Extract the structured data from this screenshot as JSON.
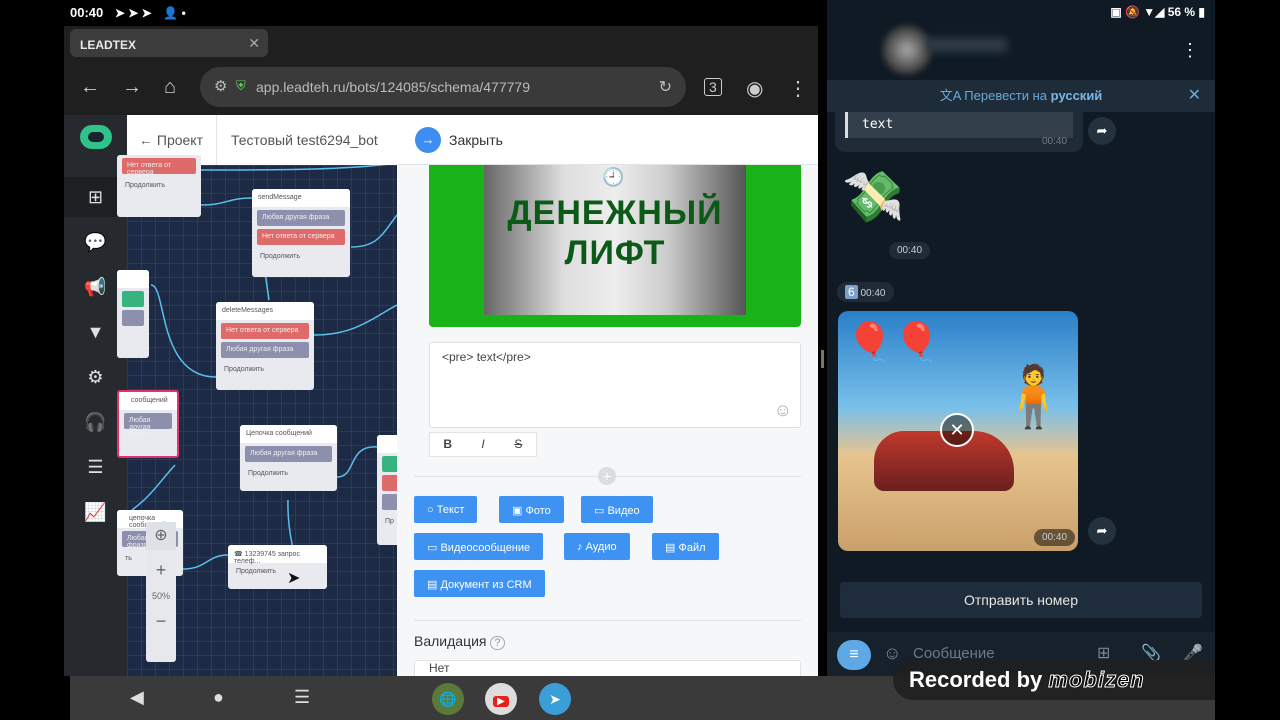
{
  "status_left": {
    "time": "00:40",
    "icons": [
      "telegram-icon",
      "telegram-icon",
      "telegram-icon",
      "person-icon",
      "dot-icon"
    ]
  },
  "status_right": {
    "battery": "56 %"
  },
  "browser": {
    "tab_title": "LEADTEX",
    "url": "app.leadteh.ru/bots/124085/schema/477779",
    "tab_count": "3"
  },
  "app": {
    "back_label": "← Проект",
    "bot_name": "Тестовый test6294_bot",
    "sidebar": [
      "schema-icon",
      "chat-icon",
      "megaphone-icon",
      "filter-icon",
      "gear-icon",
      "support-icon",
      "storage-icon",
      "chart-icon"
    ],
    "nodes": {
      "n0": {
        "row1": "Нет ответа от сервера",
        "cont": "Продолжить"
      },
      "n1": {
        "title": "sendMessage",
        "row1": "Любая другая фраза",
        "row2": "Нет ответа от сервера",
        "cont": "Продолжить"
      },
      "n2": {
        "title": "deleteMessages",
        "row1": "Нет ответа от сервера",
        "row2": "Любая другая фраза",
        "cont": "Продолжить"
      },
      "n3": {
        "title": "Цепочка сообщений",
        "row1": "Любая другая фраза",
        "cont": "Продолжить"
      },
      "n4": {
        "title": "сообщений",
        "row1": "Любая другая фраза"
      },
      "n5": {
        "title": "цепочка сообщений",
        "row1": "Любая другая фраза",
        "cont": "ть"
      },
      "n6": {
        "title": "13239745 запрос телеф...",
        "cont": "Продолжить"
      },
      "n7": {
        "cont": "Пр"
      }
    },
    "zoom": {
      "plus": "+",
      "level": "50%",
      "minus": "−"
    }
  },
  "panel": {
    "close_label": "Закрыть",
    "image_caption": "ДЕНЕЖНЫЙ ЛИФТ",
    "text_value": "<pre> text</pre>",
    "format": {
      "bold": "B",
      "italic": "I",
      "strike": "S"
    },
    "add_buttons": [
      "Текст",
      "Фото",
      "Видео",
      "Видеосообщение",
      "Аудио",
      "Файл",
      "Документ из CRM"
    ],
    "add_icons": [
      "○",
      "▣",
      "▭",
      "▭",
      "♪",
      "▤",
      "▤"
    ],
    "validation_label": "Валидация",
    "validation_value": "Нет"
  },
  "telegram": {
    "translate_prefix": "Перевести на",
    "translate_lang": "русский",
    "messages": [
      {
        "type": "pre",
        "text": "text",
        "time": "00:40"
      },
      {
        "type": "sticker",
        "time": "00:40"
      },
      {
        "type": "emoji",
        "text": "6",
        "time": "00:40"
      },
      {
        "type": "photo",
        "time": "00:40"
      }
    ],
    "keyboard_button": "Отправить номер",
    "input_placeholder": "Сообщение"
  },
  "overlay": {
    "recorded_by": "Recorded by",
    "brand": "mobizen"
  }
}
